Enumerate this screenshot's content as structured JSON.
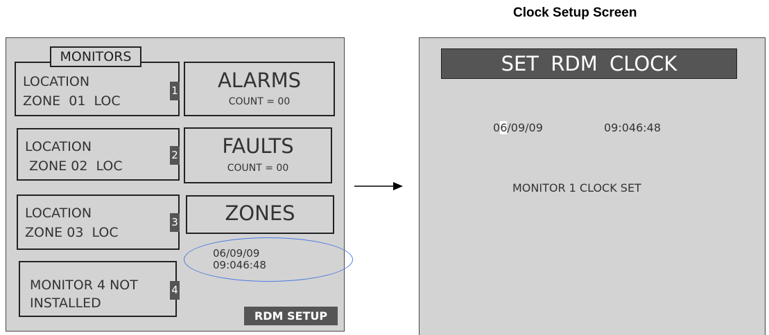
{
  "caption": "Clock Setup Screen",
  "main_screen": {
    "monitors_tab": "MONITORS",
    "monitors": [
      {
        "line1": "LOCATION",
        "line2": "ZONE  01  LOC",
        "number": "1"
      },
      {
        "line1": "LOCATION",
        "line2": " ZONE 02  LOC",
        "number": "2"
      },
      {
        "line1": "LOCATION",
        "line2": "ZONE 03  LOC",
        "number": "3"
      },
      {
        "line1": "MONITOR 4 NOT",
        "line2": "INSTALLED",
        "number": "4"
      }
    ],
    "alarms": {
      "label": "ALARMS",
      "count": "COUNT = 00"
    },
    "faults": {
      "label": "FAULTS",
      "count": "COUNT = 00"
    },
    "zones": {
      "label": "ZONES"
    },
    "date": "06/09/09",
    "time": "09:046:48",
    "rdm_setup": "RDM SETUP"
  },
  "clock_screen": {
    "title": "SET  RDM  CLOCK",
    "date_prefix": "0",
    "date_cursor": "6",
    "date_rest": "/09/09",
    "time": "09:046:48",
    "message": "MONITOR 1 CLOCK SET"
  },
  "colors": {
    "screen_bg": "#d3d3d3",
    "dark_panel": "#555555",
    "highlight_ellipse": "#4a7be0"
  }
}
